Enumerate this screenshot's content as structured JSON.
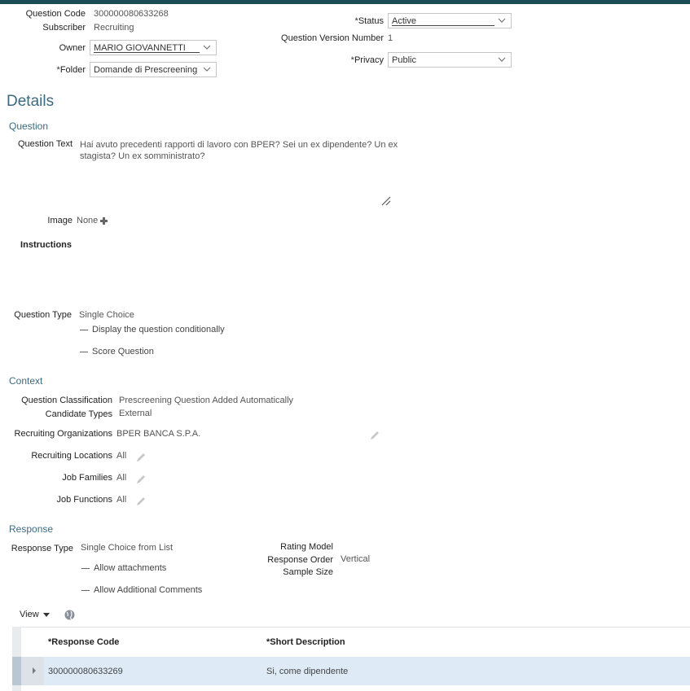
{
  "header": {
    "question_code_label": "Question Code",
    "question_code": "300000080633268",
    "subscriber_label": "Subscriber",
    "subscriber": "Recruiting",
    "owner_label": "Owner",
    "owner": "MARIO GIOVANNETTI",
    "folder_label": "Folder",
    "folder": "Domande di Prescreening",
    "status_label": "Status",
    "status": "Active",
    "version_label": "Question Version Number",
    "version": "1",
    "privacy_label": "Privacy",
    "privacy": "Public",
    "required_mark": "*"
  },
  "details": {
    "title": "Details",
    "question_section": "Question",
    "question_text_label": "Question Text",
    "question_text_line1": "Hai avuto precedenti rapporti di lavoro con BPER? Sei un ex dipendente? Un ex",
    "question_text_line2": "stagista? Un ex somministrato?",
    "image_label": "Image",
    "image_value": "None",
    "instructions_label": "Instructions",
    "question_type_label": "Question Type",
    "question_type": "Single Choice",
    "display_conditionally": "Display the question conditionally",
    "score_question": "Score Question"
  },
  "context": {
    "title": "Context",
    "classification_label": "Question Classification",
    "classification": "Prescreening Question Added Automatically",
    "candidate_types_label": "Candidate Types",
    "candidate_types": "External",
    "orgs_label": "Recruiting Organizations",
    "orgs": "BPER BANCA S.P.A.",
    "locations_label": "Recruiting Locations",
    "locations": "All",
    "families_label": "Job Families",
    "families": "All",
    "functions_label": "Job Functions",
    "functions": "All"
  },
  "response": {
    "title": "Response",
    "type_label": "Response Type",
    "type": "Single Choice from List",
    "allow_attachments": "Allow attachments",
    "allow_comments": "Allow Additional Comments",
    "rating_model_label": "Rating Model",
    "response_order_label": "Response Order",
    "response_order": "Vertical",
    "sample_size_label": "Sample Size",
    "view_menu": "View",
    "table": {
      "col_code": "Response Code",
      "col_desc": "Short Description",
      "rows": [
        {
          "code": "300000080633269",
          "desc": "Si, come dipendente"
        }
      ]
    }
  },
  "colors": {
    "accent": "#3c6b80",
    "topbar": "#1b4d56",
    "row_selected": "#deebf7"
  }
}
